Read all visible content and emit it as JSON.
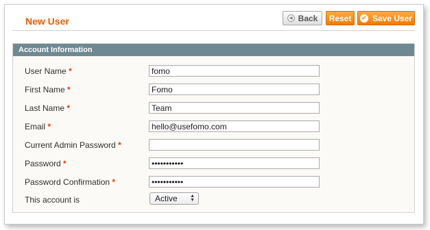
{
  "header": {
    "title": "New User",
    "back_label": "Back",
    "reset_label": "Reset",
    "save_label": "Save User"
  },
  "section": {
    "title": "Account Information"
  },
  "fields": [
    {
      "label": "User Name",
      "required": "*",
      "value": "fomo"
    },
    {
      "label": "First Name",
      "required": "*",
      "value": "Fomo"
    },
    {
      "label": "Last Name",
      "required": "*",
      "value": "Team"
    },
    {
      "label": "Email",
      "required": "*",
      "value": "hello@usefomo.com"
    },
    {
      "label": "Current Admin Password",
      "required": "*",
      "value": ""
    },
    {
      "label": "Password",
      "required": "*",
      "value": "•••••••••••"
    },
    {
      "label": "Password Confirmation",
      "required": "*",
      "value": "•••••••••••"
    }
  ],
  "status": {
    "label": "This account is",
    "selected": "Active"
  },
  "colors": {
    "accent": "#eb5e00",
    "button_orange": "#f07b00",
    "section_header": "#6f8992",
    "required": "#eb340a"
  },
  "icons": {
    "back": "back-arrow-circle-icon",
    "save": "checkmark-circle-icon",
    "select": "select-arrows-icon"
  }
}
